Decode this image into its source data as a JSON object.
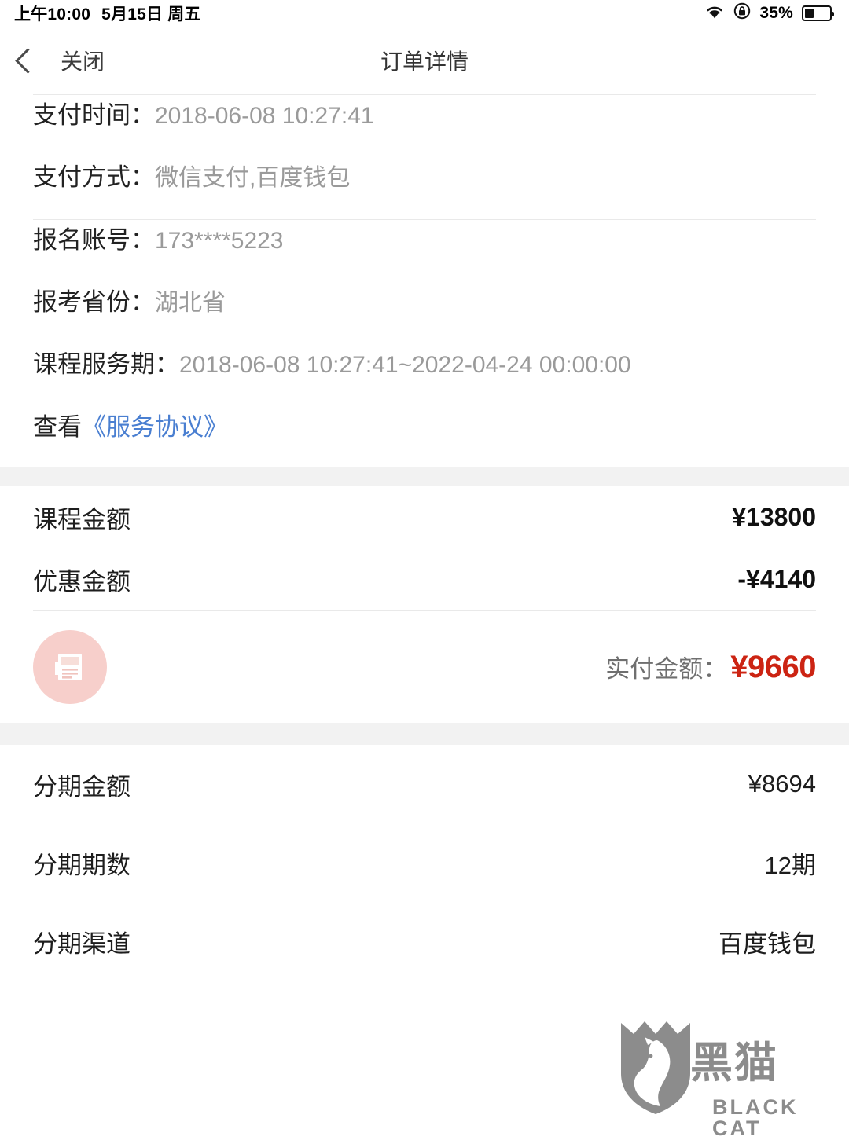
{
  "status_bar": {
    "time": "上午10:00",
    "date": "5月15日 周五",
    "battery_percent": "35%",
    "icons": [
      "wifi-icon",
      "lock-icon",
      "battery-icon"
    ]
  },
  "nav": {
    "back_label": "关闭",
    "title": "订单详情"
  },
  "payment_info": [
    {
      "label": "支付时间：",
      "value": "2018-06-08 10:27:41"
    },
    {
      "label": "支付方式：",
      "value": "微信支付,百度钱包"
    }
  ],
  "registration_info": [
    {
      "label": "报名账号：",
      "value": "173****5223"
    },
    {
      "label": "报考省份：",
      "value": "湖北省"
    },
    {
      "label": "课程服务期：",
      "value": "2018-06-08 10:27:41~2022-04-24 00:00:00"
    }
  ],
  "agreement": {
    "prefix": "查看",
    "link": "《服务协议》",
    "link_color": "#4a7fd1"
  },
  "amounts": [
    {
      "label": "课程金额",
      "value": "¥13800"
    },
    {
      "label": "优惠金额",
      "value": "-¥4140"
    }
  ],
  "paid": {
    "label": "实付金额：",
    "value": "¥9660",
    "value_color": "#cc2413",
    "icon": "receipt-icon"
  },
  "installment": [
    {
      "label": "分期金额",
      "value": "¥8694"
    },
    {
      "label": "分期期数",
      "value": "12期"
    },
    {
      "label": "分期渠道",
      "value": "百度钱包"
    }
  ],
  "watermark": {
    "cn": "黑猫",
    "en": "BLACK CAT",
    "color": "#8c8c8c"
  }
}
